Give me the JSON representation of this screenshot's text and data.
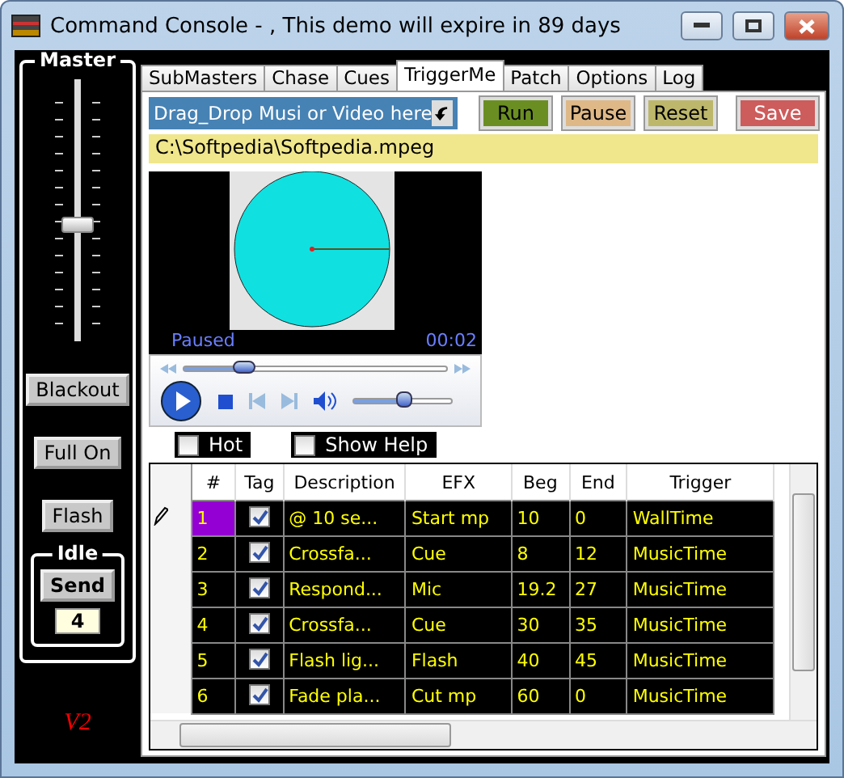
{
  "window": {
    "title": "Command Console - , This demo will expire in 89 days"
  },
  "master": {
    "title": "Master",
    "level": 0.44,
    "buttons": [
      "Blackout",
      "Full On",
      "Flash"
    ],
    "idle": {
      "title": "Idle",
      "send": "Send",
      "value": "4"
    },
    "version": "V2"
  },
  "tabs": [
    {
      "label": "SubMasters",
      "selected": false
    },
    {
      "label": "Chase",
      "selected": false
    },
    {
      "label": "Cues",
      "selected": false
    },
    {
      "label": "TriggerMe",
      "selected": true
    },
    {
      "label": "Patch",
      "selected": false
    },
    {
      "label": "Options",
      "selected": false
    },
    {
      "label": "Log",
      "selected": false
    }
  ],
  "drop_zone": {
    "label": "Drag_Drop Musi or Video here"
  },
  "actions": [
    {
      "label": "Run",
      "color": "#6b8e23"
    },
    {
      "label": "Pause",
      "color": "#deb887"
    },
    {
      "label": "Reset",
      "color": "#bdb76b"
    },
    {
      "label": "Save",
      "color": "#cd5c5c"
    }
  ],
  "file_path": "C:\\Softpedia\\Softpedia.mpeg",
  "player": {
    "status": "Paused",
    "time": "00:02",
    "seek": {
      "level": 0.23
    },
    "volume": {
      "level": 0.52
    }
  },
  "options": [
    {
      "label": "Hot",
      "checked": false
    },
    {
      "label": "Show Help",
      "checked": false
    }
  ],
  "table": {
    "columns": [
      "#",
      "Tag",
      "Description",
      "EFX",
      "Beg",
      "End",
      "Trigger"
    ],
    "rows": [
      {
        "number": "1",
        "tag": true,
        "description": "@ 10 se...",
        "efx": "Start mp",
        "beg": "10",
        "end": "0",
        "trigger": "WallTime",
        "selected": true
      },
      {
        "number": "2",
        "tag": true,
        "description": "Crossfa...",
        "efx": "Cue",
        "beg": "8",
        "end": "12",
        "trigger": "MusicTime",
        "selected": false
      },
      {
        "number": "3",
        "tag": true,
        "description": "Respond...",
        "efx": "Mic",
        "beg": "19.2",
        "end": "27",
        "trigger": "MusicTime",
        "selected": false
      },
      {
        "number": "4",
        "tag": true,
        "description": "Crossfa...",
        "efx": "Cue",
        "beg": "30",
        "end": "35",
        "trigger": "MusicTime",
        "selected": false
      },
      {
        "number": "5",
        "tag": true,
        "description": "Flash  lig...",
        "efx": "Flash",
        "beg": "40",
        "end": "45",
        "trigger": "MusicTime",
        "selected": false
      },
      {
        "number": "6",
        "tag": true,
        "description": "Fade pla...",
        "efx": "Cut mp",
        "beg": "60",
        "end": "0",
        "trigger": "MusicTime",
        "selected": false
      }
    ]
  }
}
